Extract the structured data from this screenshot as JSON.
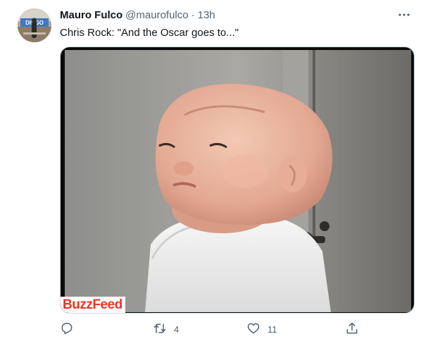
{
  "tweet": {
    "author": {
      "display_name": "Mauro Fulco",
      "handle": "@maurofulco",
      "avatar_icon": "profile-avatar"
    },
    "separator": "·",
    "time": "13h",
    "text": "Chris Rock: \"And the Oscar goes to...\"",
    "more_icon": "more-horizontal-icon",
    "media": {
      "watermark": "BuzzFeed",
      "watermark_color": "#ee3322"
    }
  },
  "actions": {
    "reply": {
      "icon": "reply-icon",
      "count": ""
    },
    "retweet": {
      "icon": "retweet-icon",
      "count": "4"
    },
    "like": {
      "icon": "heart-icon",
      "count": "11"
    },
    "share": {
      "icon": "share-icon"
    }
  },
  "colors": {
    "text_primary": "#0f1419",
    "text_secondary": "#536471",
    "border": "#cfd9de"
  }
}
